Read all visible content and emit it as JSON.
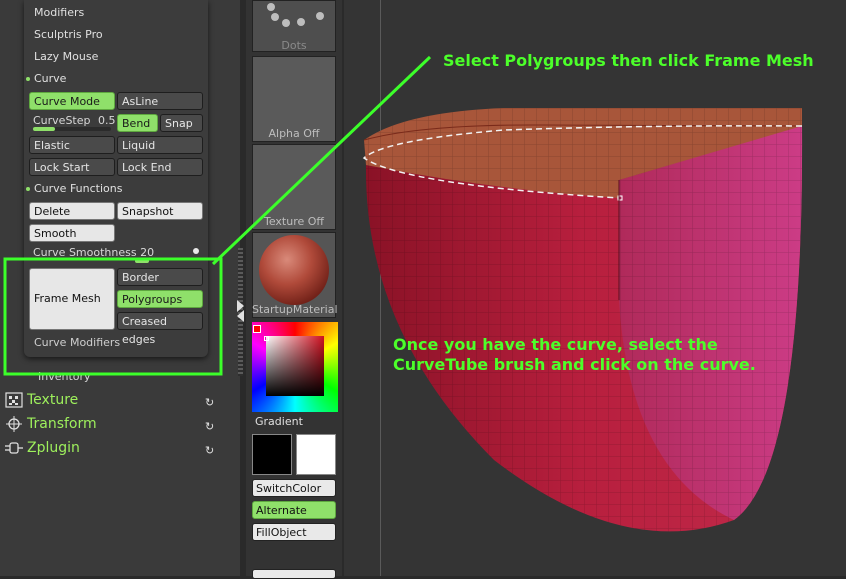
{
  "palette": {
    "items": {
      "modifiers": "Modifiers",
      "sculptris_pro": "Sculptris Pro",
      "lazy_mouse": "Lazy Mouse"
    },
    "curve": {
      "section_label": "Curve",
      "curve_mode": "Curve Mode",
      "asline": "AsLine",
      "curvestep_label": "CurveStep",
      "curvestep_value": "0.5",
      "bend": "Bend",
      "snap": "Snap",
      "elastic": "Elastic",
      "liquid": "Liquid",
      "lock_start": "Lock Start",
      "lock_end": "Lock End"
    },
    "curve_functions": {
      "section_label": "Curve Functions",
      "delete": "Delete",
      "snapshot": "Snapshot",
      "smooth": "Smooth",
      "smoothness_label": "Curve Smoothness",
      "smoothness_value": "20",
      "frame_mesh": "Frame Mesh",
      "border": "Border",
      "polygroups": "Polygroups",
      "creased_edges": "Creased edges",
      "curve_modifiers": "Curve Modifiers"
    },
    "inventory": "Inventory"
  },
  "menus": [
    {
      "label": "Texture",
      "icon": "texture-icon"
    },
    {
      "label": "Transform",
      "icon": "transform-icon"
    },
    {
      "label": "Zplugin",
      "icon": "zplugin-icon"
    }
  ],
  "shelf": {
    "dots": "Dots",
    "alpha": "Alpha Off",
    "texture": "Texture Off",
    "material": "StartupMaterial",
    "gradient": "Gradient",
    "switch_color": "SwitchColor",
    "alternate": "Alternate",
    "fill_object": "FillObject"
  },
  "annotations": {
    "top": "Select Polygroups then click Frame Mesh",
    "bottom_line1": "Once you have the curve, select the",
    "bottom_line2": "CurveTube brush and click on the curve."
  },
  "colors": {
    "accent_green": "#8fe06a",
    "annotation_green": "#4cff2a",
    "mesh_red": "#b3203c",
    "mesh_pink": "#c8357a",
    "mesh_rim": "#a8563a"
  }
}
